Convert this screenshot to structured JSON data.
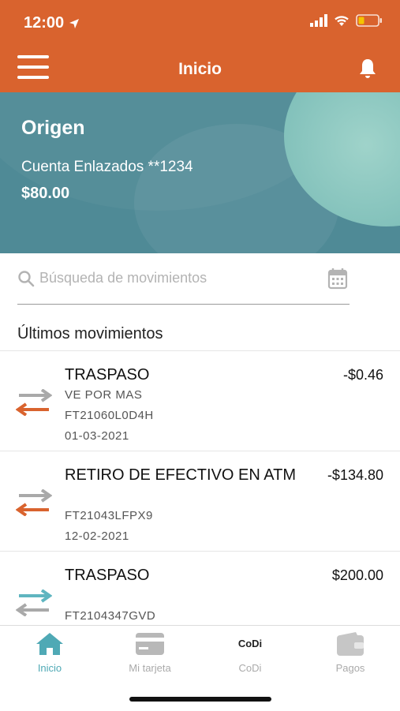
{
  "status_bar": {
    "time": "12:00"
  },
  "header": {
    "title": "Inicio"
  },
  "account": {
    "title": "Origen",
    "name": "Cuenta Enlazados **1234",
    "balance": "$80.00"
  },
  "search": {
    "placeholder": "Búsqueda de movimientos"
  },
  "movements": {
    "section_title": "Últimos movimientos",
    "items": [
      {
        "title": "TRASPASO",
        "amount": "-$0.46",
        "desc": "VE POR MAS",
        "ref": "FT21060L0D4H",
        "date": "01-03-2021",
        "direction": "out"
      },
      {
        "title": "RETIRO DE EFECTIVO EN ATM",
        "amount": "-$134.80",
        "desc": "",
        "ref": "FT21043LFPX9",
        "date": "12-02-2021",
        "direction": "out"
      },
      {
        "title": "TRASPASO",
        "amount": "$200.00",
        "desc": "",
        "ref": "FT2104347GVD",
        "date": "",
        "direction": "in"
      }
    ]
  },
  "tabs": [
    {
      "label": "Inicio",
      "icon": "home-icon",
      "active": true
    },
    {
      "label": "Mi tarjeta",
      "icon": "card-icon",
      "active": false
    },
    {
      "label": "CoDi",
      "icon": "codi-icon",
      "active": false
    },
    {
      "label": "Pagos",
      "icon": "wallet-icon",
      "active": false
    }
  ],
  "colors": {
    "header": "#D9632E",
    "hero": "#4F8A96",
    "accent": "#4FA9B5",
    "outgoing_arrow": "#D9632E",
    "incoming_arrow": "#5FB5C0",
    "neutral_arrow": "#A9A9A9"
  }
}
